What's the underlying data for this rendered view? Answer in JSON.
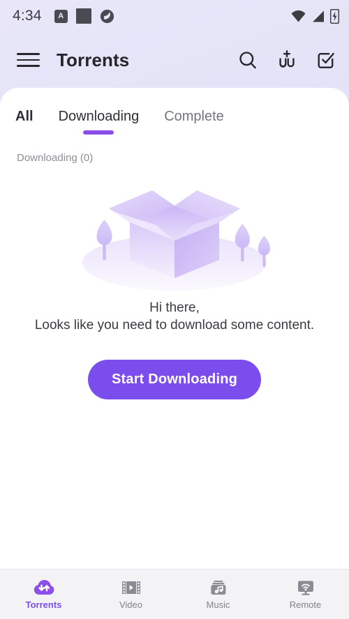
{
  "status_bar": {
    "time": "4:34",
    "left_icons": [
      "letter-a-badge-icon",
      "square-notification-icon",
      "bittorrent-logo-icon"
    ],
    "right_icons": [
      "wifi-icon",
      "cellular-signal-icon",
      "battery-charging-icon"
    ]
  },
  "app_bar": {
    "menu_icon": "hamburger-menu-icon",
    "title": "Torrents",
    "actions": [
      {
        "name": "search-icon",
        "label": "Search"
      },
      {
        "name": "add-torrent-icon",
        "label": "Add torrent"
      },
      {
        "name": "select-all-icon",
        "label": "Select"
      }
    ]
  },
  "tabs": [
    {
      "label": "All",
      "active": false,
      "bold": true
    },
    {
      "label": "Downloading",
      "active": true,
      "bold": false
    },
    {
      "label": "Complete",
      "active": false,
      "bold": false
    }
  ],
  "section": {
    "label": "Downloading (0)"
  },
  "empty_state": {
    "illustration": "empty-box-illustration",
    "line1": "Hi there,",
    "line2": "Looks like you need to download some content.",
    "cta_label": "Start Downloading"
  },
  "bottom_nav": [
    {
      "label": "Torrents",
      "icon": "cloud-transfer-icon",
      "active": true
    },
    {
      "label": "Video",
      "icon": "film-play-icon",
      "active": false
    },
    {
      "label": "Music",
      "icon": "music-box-icon",
      "active": false
    },
    {
      "label": "Remote",
      "icon": "remote-screen-wifi-icon",
      "active": false
    }
  ],
  "colors": {
    "accent": "#7b4ded",
    "tab_indicator": "#8b4de8",
    "header_bg": "#e6e4f7",
    "card_bg": "#ffffff",
    "nav_bg": "#f3f3f5",
    "inactive_text": "#81818b",
    "illustration_purple": "#c9b6f5"
  }
}
